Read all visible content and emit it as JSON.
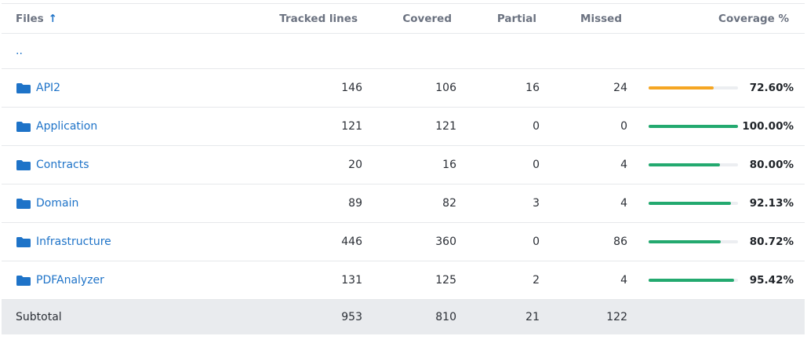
{
  "header": {
    "files": "Files",
    "tracked": "Tracked lines",
    "covered": "Covered",
    "partial": "Partial",
    "missed": "Missed",
    "coverage": "Coverage %"
  },
  "parent_link": "..",
  "rows": [
    {
      "name": "API2",
      "tracked": "146",
      "covered": "106",
      "partial": "16",
      "missed": "24",
      "pct": "72.60%",
      "fill": 0.726,
      "color": "#f5a623"
    },
    {
      "name": "Application",
      "tracked": "121",
      "covered": "121",
      "partial": "0",
      "missed": "0",
      "pct": "100.00%",
      "fill": 1.0,
      "color": "#23a96f"
    },
    {
      "name": "Contracts",
      "tracked": "20",
      "covered": "16",
      "partial": "0",
      "missed": "4",
      "pct": "80.00%",
      "fill": 0.8,
      "color": "#23a96f"
    },
    {
      "name": "Domain",
      "tracked": "89",
      "covered": "82",
      "partial": "3",
      "missed": "4",
      "pct": "92.13%",
      "fill": 0.9213,
      "color": "#23a96f"
    },
    {
      "name": "Infrastructure",
      "tracked": "446",
      "covered": "360",
      "partial": "0",
      "missed": "86",
      "pct": "80.72%",
      "fill": 0.8072,
      "color": "#23a96f"
    },
    {
      "name": "PDFAnalyzer",
      "tracked": "131",
      "covered": "125",
      "partial": "2",
      "missed": "4",
      "pct": "95.42%",
      "fill": 0.9542,
      "color": "#23a96f"
    }
  ],
  "subtotal": {
    "label": "Subtotal",
    "tracked": "953",
    "covered": "810",
    "partial": "21",
    "missed": "122"
  }
}
